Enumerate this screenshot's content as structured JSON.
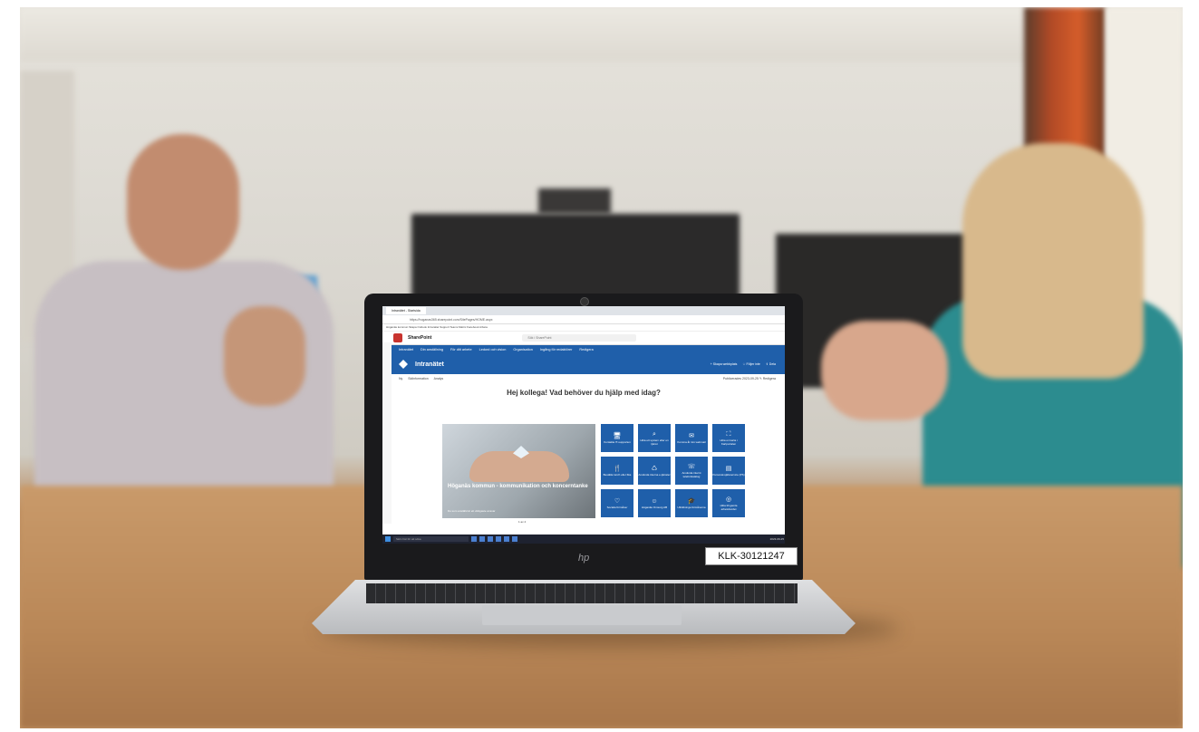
{
  "browser": {
    "tab_label": "Intranätet - Startsida",
    "url": "https://hoganas365.sharepoint.com/SitePages/HOME.aspx",
    "bookmarks": "Höganäs kommun   Skapa Outlook   Intranätet   Support   Teams   Matrix   Facebook   Arbeta"
  },
  "sharepoint": {
    "brand": "SharePoint",
    "search_placeholder": "Sök i SharePoint",
    "site_title": "Intranätet",
    "nav": [
      "Intranätet",
      "Din anställning",
      "För ditt arbete",
      "Ledord och vision",
      "Organisation",
      "Ingång för redaktörer",
      "Redigera"
    ],
    "actions": [
      "+ Skapa webbplats",
      "☆ Följer inte",
      "⇪ Dela"
    ],
    "cmd_left": [
      "Ny",
      "Sidinformation",
      "Analys"
    ],
    "cmd_right": "Publicerades 2023-09-25   ✎ Redigera",
    "greeting": "Hej kollega! Vad behöver du hjälp med idag?",
    "carousel": {
      "headline": "Höganäs kommun - kommunikation och koncerntanke",
      "sub": "Du som anställd är ett viktigaste ansvar",
      "pager": "1 av 4"
    },
    "tiles": [
      {
        "icon": "🖥",
        "label": "Kontakta IT-supporten"
      },
      {
        "icon": "⌕",
        "label": "Hitta ett system eller en tjänst"
      },
      {
        "icon": "✉",
        "label": "Komma åt min webmail"
      },
      {
        "icon": "⛶",
        "label": "Hitta en karta i Kartportalen"
      },
      {
        "icon": "🍴",
        "label": "Beställa lunch eller fika"
      },
      {
        "icon": "♺",
        "label": "Använda interna e-tjänster"
      },
      {
        "icon": "☏",
        "label": "Använda internt telefonkatalog"
      },
      {
        "icon": "▤",
        "label": "Personal-självservice (PS)"
      },
      {
        "icon": "♡",
        "label": "Sociala förmåner"
      },
      {
        "icon": "☺",
        "label": "Höganäs Omsorg AB"
      },
      {
        "icon": "🎓",
        "label": "Utbildnings-förmånerna"
      },
      {
        "icon": "◎",
        "label": "Hitta till gamla arbetsbordet"
      }
    ]
  },
  "taskbar": {
    "search_placeholder": "Skriv här för att söka",
    "clock": "2023-09-25"
  },
  "hardware": {
    "brand_logo": "hp",
    "asset_tag": "KLK-30121247"
  }
}
